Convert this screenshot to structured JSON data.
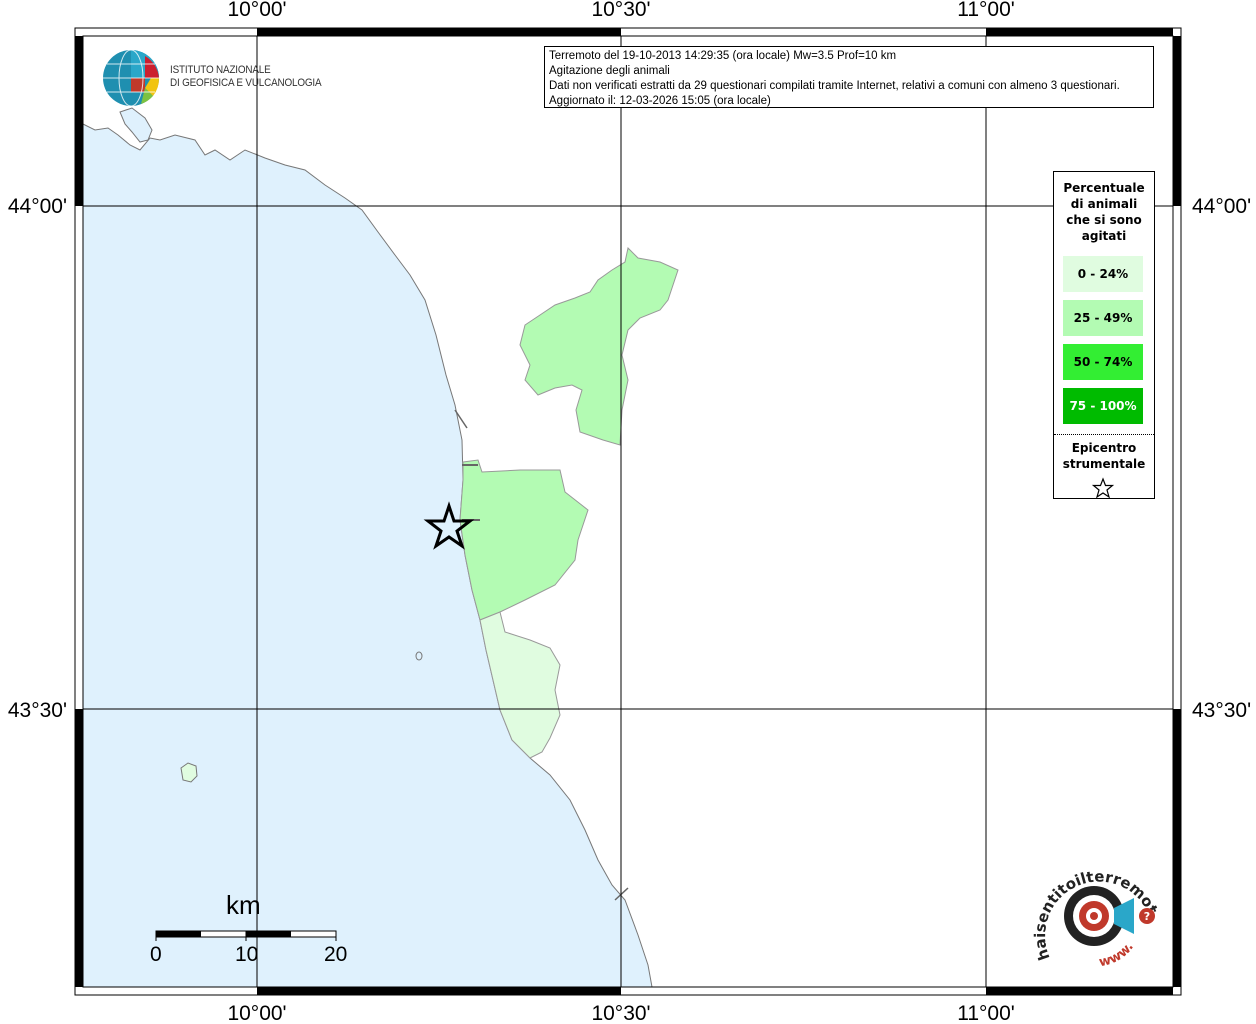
{
  "map": {
    "title_lines": [
      "Terremoto del 19-10-2013 14:29:35 (ora locale) Mw=3.5 Prof=10 km",
      "Agitazione degli animali",
      "Dati non verificati estratti da 29 questionari compilati tramite Internet, relativi a comuni con almeno 3 questionari.",
      "Aggiornato il: 12-03-2026 15:05 (ora locale)"
    ],
    "lon_ticks": [
      "10°00'",
      "10°30'",
      "11°00'"
    ],
    "lat_ticks": [
      "44°00'",
      "43°30'"
    ],
    "colors": {
      "sea": "#dff1fd",
      "land": "#ffffff",
      "class_0_24": "#e0fce0",
      "class_25_49": "#b3fbb3",
      "class_50_74": "#33ee33",
      "class_75_100": "#00bb00",
      "grid": "#000000"
    }
  },
  "legend": {
    "title_lines": [
      "Percentuale",
      "di animali",
      "che si sono",
      "agitati"
    ],
    "classes": [
      "0 - 24%",
      "25 - 49%",
      "50 - 74%",
      "75 - 100%"
    ],
    "epicenter_lines": [
      "Epicentro",
      "strumentale"
    ]
  },
  "scale_bar": {
    "unit": "km",
    "ticks": [
      "0",
      "10",
      "20"
    ]
  },
  "logos": {
    "ingv_lines": [
      "ISTITUTO NAZIONALE",
      "DI GEOFISICA E VULCANOLOGIA"
    ],
    "hsit_text": "haisentitoilterremoto.it",
    "hsit_www": "www."
  }
}
